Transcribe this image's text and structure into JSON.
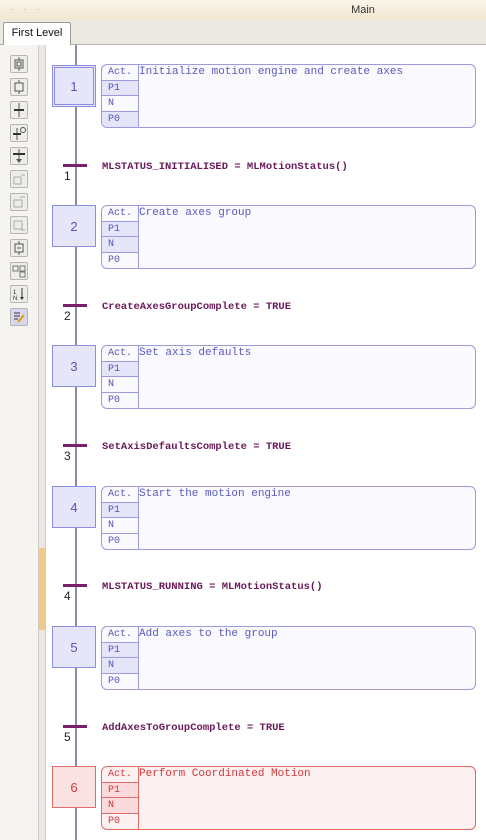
{
  "window": {
    "title": "Main"
  },
  "tabs": [
    {
      "label": "First Level"
    }
  ],
  "toolbar": {
    "buttons": [
      "init-step-icon",
      "step-icon",
      "transition-icon",
      "step-transition-icon",
      "jump-icon",
      "branch-icon",
      "divergence-icon",
      "convergence-icon",
      "macro-step-icon",
      "parallel-icon",
      "sort-icon",
      "edit-action-icon"
    ]
  },
  "sfc": {
    "steps": [
      {
        "number": "1",
        "action": "Initialize motion engine and create axes",
        "qualifiers": [
          "Act.",
          "P1",
          "N",
          "P0"
        ]
      },
      {
        "number": "2",
        "action": "Create axes group",
        "qualifiers": [
          "Act.",
          "P1",
          "N",
          "P0"
        ]
      },
      {
        "number": "3",
        "action": "Set axis defaults",
        "qualifiers": [
          "Act.",
          "P1",
          "N",
          "P0"
        ]
      },
      {
        "number": "4",
        "action": "Start the motion engine",
        "qualifiers": [
          "Act.",
          "P1",
          "N",
          "P0"
        ]
      },
      {
        "number": "5",
        "action": "Add axes to the group",
        "qualifiers": [
          "Act.",
          "P1",
          "N",
          "P0"
        ]
      },
      {
        "number": "6",
        "action": "Perform Coordinated Motion",
        "qualifiers": [
          "Act.",
          "P1",
          "N",
          "P0"
        ]
      }
    ],
    "transitions": [
      {
        "number": "1",
        "condition": "MLSTATUS_INITIALISED = MLMotionStatus()"
      },
      {
        "number": "2",
        "condition": "CreateAxesGroupComplete = TRUE"
      },
      {
        "number": "3",
        "condition": "SetAxisDefaultsComplete = TRUE"
      },
      {
        "number": "4",
        "condition": "MLSTATUS_RUNNING = MLMotionStatus()"
      },
      {
        "number": "5",
        "condition": "AddAxesToGroupComplete = TRUE"
      }
    ]
  },
  "colors": {
    "step_fill": "#e6e6fb",
    "step_border": "#8e8ee0",
    "active_step_fill": "#fbe2e2",
    "active_step_border": "#e06b6b",
    "transition_bar": "#7a1f6e"
  }
}
